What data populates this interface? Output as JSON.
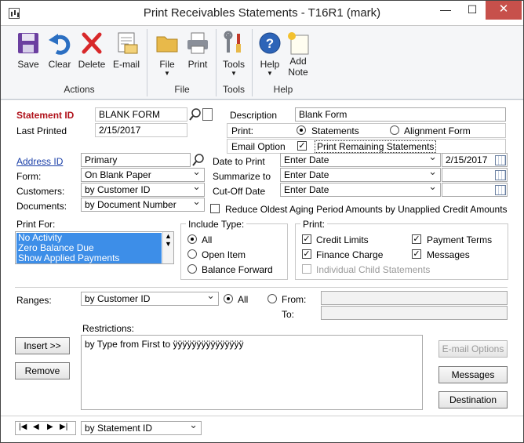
{
  "window": {
    "title": "Print Receivables Statements  -  T16R1 (mark)",
    "minimize": "—",
    "maximize": "☐",
    "close": "✕"
  },
  "ribbon": {
    "save": "Save",
    "clear": "Clear",
    "delete": "Delete",
    "email": "E-mail",
    "file": "File",
    "print": "Print",
    "tools": "Tools",
    "help": "Help",
    "add_note_1": "Add",
    "add_note_2": "Note",
    "group_actions": "Actions",
    "group_file": "File",
    "group_tools": "Tools",
    "group_help": "Help",
    "icons": {
      "save": "floppy-disk-icon",
      "clear": "undo-arrow-icon",
      "delete": "red-x-icon",
      "email": "envelope-icon",
      "file": "folder-icon",
      "print": "printer-icon",
      "tools": "wrench-screwdriver-icon",
      "help": "question-circle-icon",
      "add_note": "note-icon"
    }
  },
  "header": {
    "statement_id_label": "Statement ID",
    "statement_id_value": "BLANK FORM",
    "last_printed_label": "Last Printed",
    "last_printed_value": "2/15/2017",
    "description_label": "Description",
    "description_value": "Blank Form",
    "print_label": "Print:",
    "print_statements": "Statements",
    "print_alignment": "Alignment Form",
    "email_option_label": "Email Option",
    "print_remaining": "Print Remaining Statements"
  },
  "fields": {
    "address_id_label": "Address ID",
    "address_id_value": "Primary",
    "form_label": "Form:",
    "form_value": "On Blank Paper",
    "customers_label": "Customers:",
    "customers_value": "by Customer ID",
    "documents_label": "Documents:",
    "documents_value": "by Document Number",
    "date_to_print_label": "Date to Print",
    "date_to_print_value": "Enter Date",
    "date_to_print_date": "2/15/2017",
    "summarize_to_label": "Summarize to",
    "summarize_to_value": "Enter Date",
    "cutoff_label": "Cut-Off Date",
    "cutoff_value": "Enter Date",
    "reduce_label": "Reduce Oldest Aging Period Amounts by Unapplied Credit Amounts"
  },
  "print_for": {
    "label": "Print For:",
    "items": [
      "No Activity",
      "Zero Balance Due",
      "Show Applied Payments"
    ]
  },
  "include_type": {
    "label": "Include Type:",
    "all": "All",
    "open_item": "Open Item",
    "balance_forward": "Balance Forward"
  },
  "print_options": {
    "label": "Print:",
    "credit_limits": "Credit Limits",
    "payment_terms": "Payment Terms",
    "finance_charge": "Finance Charge",
    "messages": "Messages",
    "child_statements": "Individual Child Statements"
  },
  "ranges": {
    "label": "Ranges:",
    "value": "by Customer ID",
    "all": "All",
    "from": "From:",
    "to": "To:"
  },
  "restrictions": {
    "label": "Restrictions:",
    "items": [
      "by Type from First to ÿÿÿÿÿÿÿÿÿÿÿÿÿÿÿ"
    ]
  },
  "buttons": {
    "insert": "Insert >>",
    "remove": "Remove",
    "email_options": "E-mail Options",
    "messages": "Messages",
    "destination": "Destination"
  },
  "footer": {
    "sort_value": "by Statement ID"
  }
}
